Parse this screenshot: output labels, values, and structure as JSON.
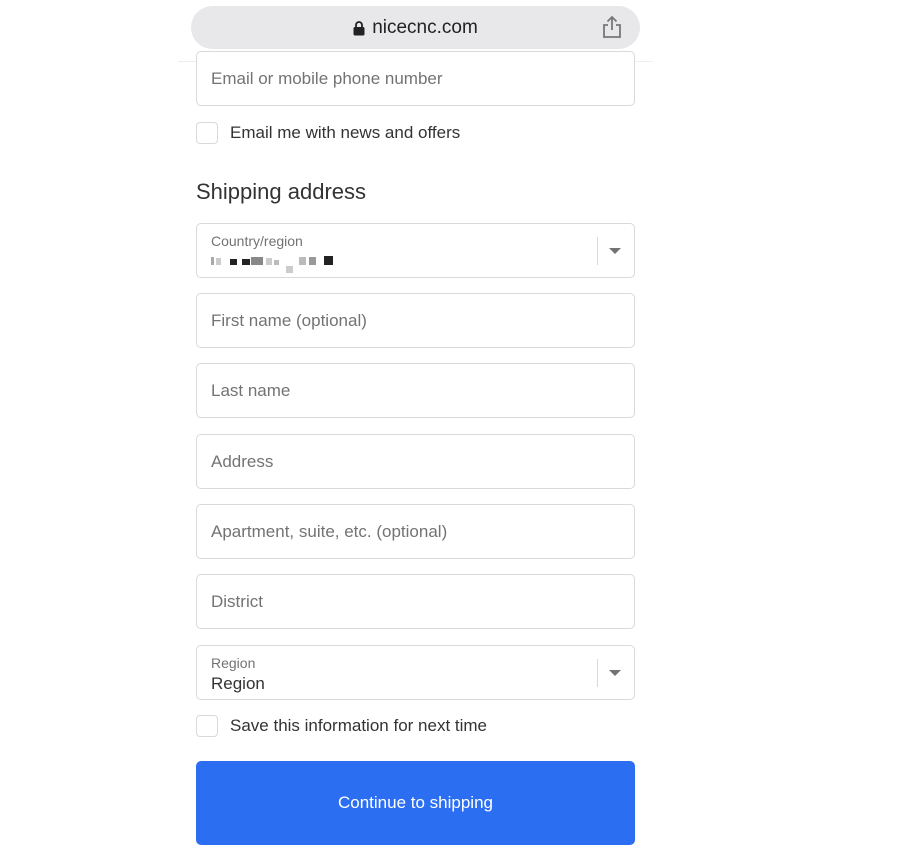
{
  "browser": {
    "url": "nicecnc.com",
    "icons": [
      "lock-icon",
      "share-icon"
    ]
  },
  "contact": {
    "email_placeholder": "Email or mobile phone number",
    "newsletter_label": "Email me with news and offers"
  },
  "shipping": {
    "title": "Shipping address",
    "country_label": "Country/region",
    "first_name_placeholder": "First name (optional)",
    "last_name_placeholder": "Last name",
    "address_placeholder": "Address",
    "apartment_placeholder": "Apartment, suite, etc. (optional)",
    "district_placeholder": "District",
    "region_label": "Region",
    "region_value": "Region",
    "save_label": "Save this information for next time"
  },
  "actions": {
    "continue_label": "Continue to shipping"
  },
  "colors": {
    "primary": "#2c6ef2",
    "border": "#d9d9d9",
    "placeholder": "#737373"
  }
}
